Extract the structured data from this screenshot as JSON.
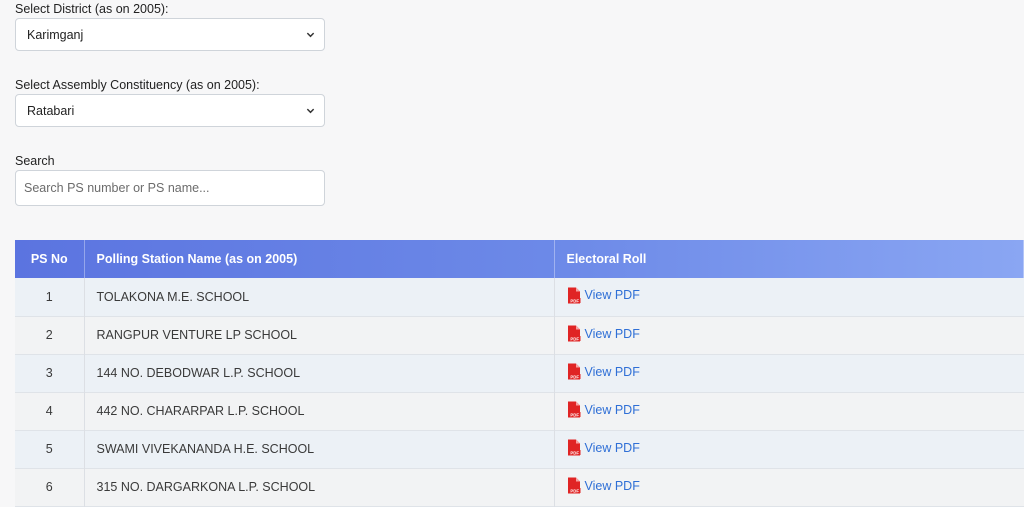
{
  "district": {
    "label": "Select District (as on 2005):",
    "selected": "Karimganj"
  },
  "assembly": {
    "label": "Select Assembly Constituency (as on 2005):",
    "selected": "Ratabari"
  },
  "search": {
    "label": "Search",
    "placeholder": "Search PS number or PS name..."
  },
  "table": {
    "headers": {
      "ps_no": "PS No",
      "name": "Polling Station Name (as on 2005)",
      "roll": "Electoral Roll"
    },
    "rows": [
      {
        "no": "1",
        "name": "TOLAKONA M.E. SCHOOL",
        "link": "View PDF"
      },
      {
        "no": "2",
        "name": "RANGPUR VENTURE LP SCHOOL",
        "link": "View PDF"
      },
      {
        "no": "3",
        "name": "144 NO. DEBODWAR L.P. SCHOOL",
        "link": "View PDF"
      },
      {
        "no": "4",
        "name": "442 NO. CHARARPAR L.P. SCHOOL",
        "link": "View PDF"
      },
      {
        "no": "5",
        "name": "SWAMI VIVEKANANDA H.E. SCHOOL",
        "link": "View PDF"
      },
      {
        "no": "6",
        "name": "315 NO. DARGARKONA L.P. SCHOOL",
        "link": "View PDF"
      }
    ]
  },
  "icons": {
    "caret": "chevron-down-icon",
    "pdf": "pdf-file-icon",
    "pdf_color": "#e02424"
  },
  "colors": {
    "header_start": "#5b74e0",
    "header_end": "#8aa6f3",
    "link": "#2f6fd6"
  }
}
